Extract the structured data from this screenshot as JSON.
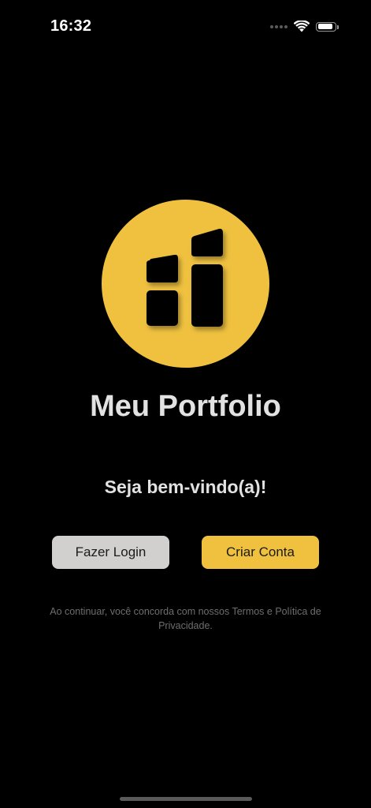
{
  "status_bar": {
    "time": "16:32",
    "battery_level": 0.9
  },
  "app": {
    "title": "Meu Portfolio",
    "welcome": "Seja bem-vindo(a)!"
  },
  "buttons": {
    "login_label": "Fazer Login",
    "signup_label": "Criar Conta"
  },
  "terms_text": "Ao continuar, você concorda com nossos Termos e Política de Privacidade.",
  "colors": {
    "accent": "#efc13f",
    "background": "#000000",
    "secondary_button": "#d2cfcf"
  },
  "icons": {
    "logo": "portfolio-blocks-logo",
    "wifi": "wifi-icon",
    "battery": "battery-icon",
    "signal": "cellular-signal-icon"
  }
}
